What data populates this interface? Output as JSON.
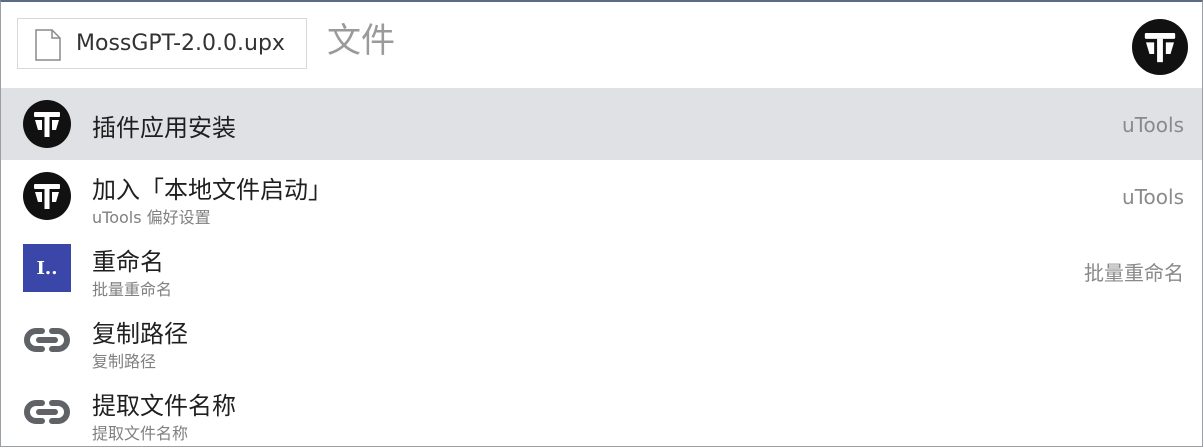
{
  "header": {
    "file_name": "MossGPT-2.0.0.upx",
    "query": "文件"
  },
  "results": [
    {
      "title": "插件应用安装",
      "subtitle": "",
      "source": "uTools",
      "icon": "utools-logo-icon",
      "selected": true
    },
    {
      "title": "加入「本地文件启动」",
      "subtitle": "uTools 偏好设置",
      "source": "uTools",
      "icon": "utools-logo-icon",
      "selected": false
    },
    {
      "title": "重命名",
      "subtitle": "批量重命名",
      "source": "批量重命名",
      "icon": "batch-rename-icon",
      "icon_text": "I..",
      "selected": false
    },
    {
      "title": "复制路径",
      "subtitle": "复制路径",
      "source": "",
      "icon": "link-icon",
      "selected": false
    },
    {
      "title": "提取文件名称",
      "subtitle": "提取文件名称",
      "source": "",
      "icon": "link-icon",
      "selected": false
    }
  ],
  "colors": {
    "selected_row": "#dfe1e5",
    "rename_icon_bg": "#3a46a8",
    "link_icon": "#5f6368"
  }
}
